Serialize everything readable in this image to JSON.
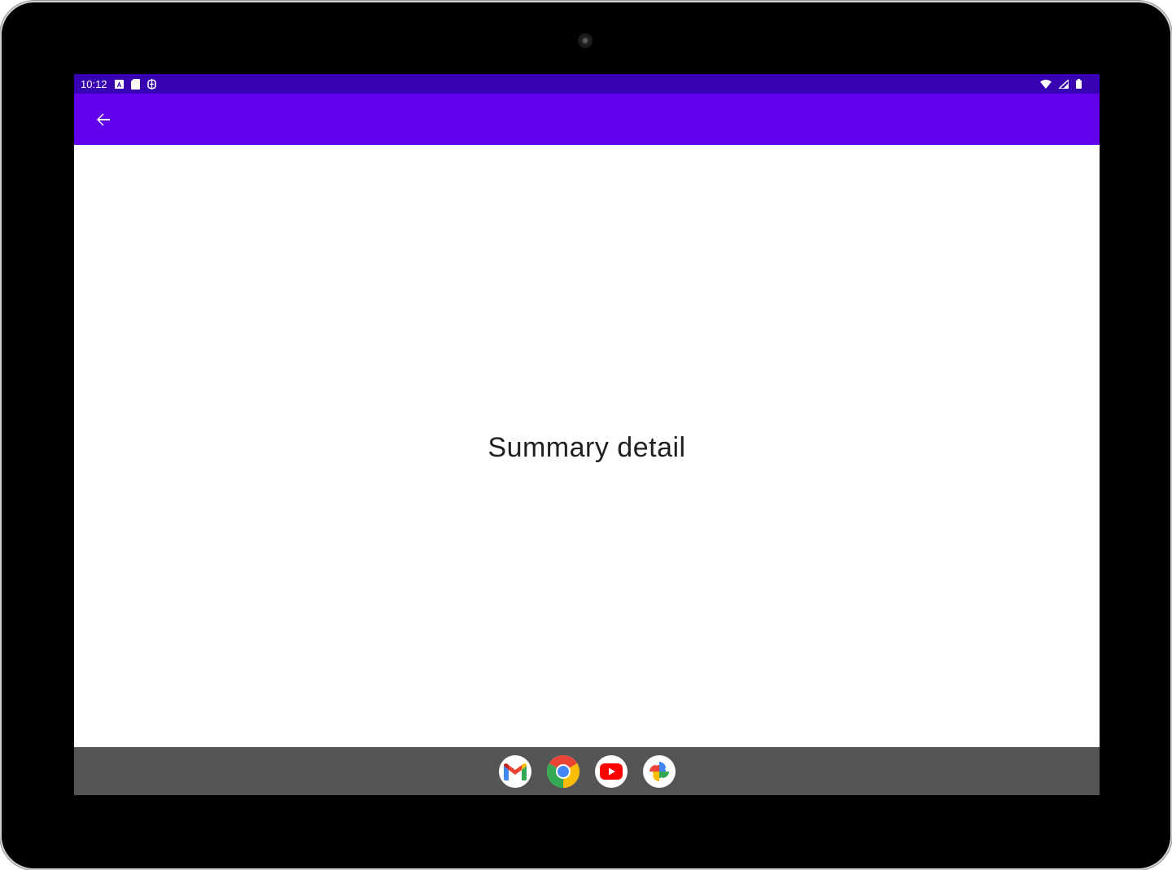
{
  "status_bar": {
    "time": "10:12",
    "left_icons": [
      "accessibility-icon",
      "sd-card-icon",
      "data-saver-icon"
    ],
    "right_icons": [
      "wifi-icon",
      "cell-signal-icon",
      "battery-icon"
    ]
  },
  "app_bar": {
    "back_icon": "arrow-back-icon",
    "color": "#6200ee"
  },
  "content": {
    "detail_text": "Summary detail"
  },
  "taskbar": {
    "apps": [
      "Gmail",
      "Chrome",
      "YouTube",
      "Photos"
    ]
  },
  "colors": {
    "status_bar": "#3700b3",
    "app_bar": "#6200ee",
    "taskbar": "#555555"
  }
}
